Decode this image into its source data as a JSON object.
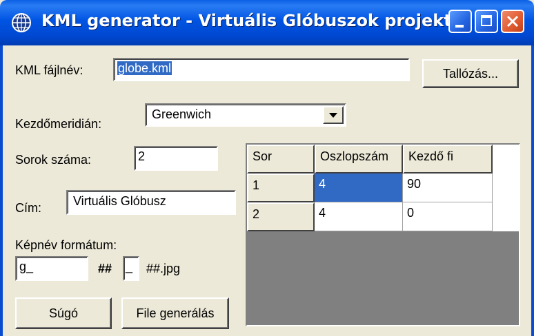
{
  "window": {
    "title": "KML generator - Virtuális Glóbuszok projekt",
    "icon": "globe-icon",
    "controls": [
      "minimize-icon",
      "maximize-icon",
      "close-icon"
    ]
  },
  "form": {
    "kml_filename_label": "KML fájlnév:",
    "kml_filename_value": "globe.kml",
    "browse_button": "Tallózás...",
    "meridian_label": "Kezdőmeridián:",
    "meridian_value": "Greenwich",
    "rows_label": "Sorok száma:",
    "rows_value": "2",
    "title_label": "Cím:",
    "title_value": "Virtuális Glóbusz",
    "image_format_label": "Képnév formátum:",
    "image_prefix_value": "g_",
    "hash1": "##",
    "image_separator_value": "_",
    "hash2_suffix": "##.jpg"
  },
  "buttons": {
    "help": "Súgó",
    "generate": "File generálás"
  },
  "grid": {
    "headers": [
      "Sor",
      "Oszlopszám",
      "Kezdő fi"
    ],
    "rows": [
      {
        "sor": "1",
        "oszlopszam": "4",
        "kezdo_fi": "90"
      },
      {
        "sor": "2",
        "oszlopszam": "4",
        "kezdo_fi": "0"
      }
    ]
  },
  "colors": {
    "titlebar": "#0054e3",
    "selection": "#316ac5",
    "window_bg": "#ece9d8"
  }
}
